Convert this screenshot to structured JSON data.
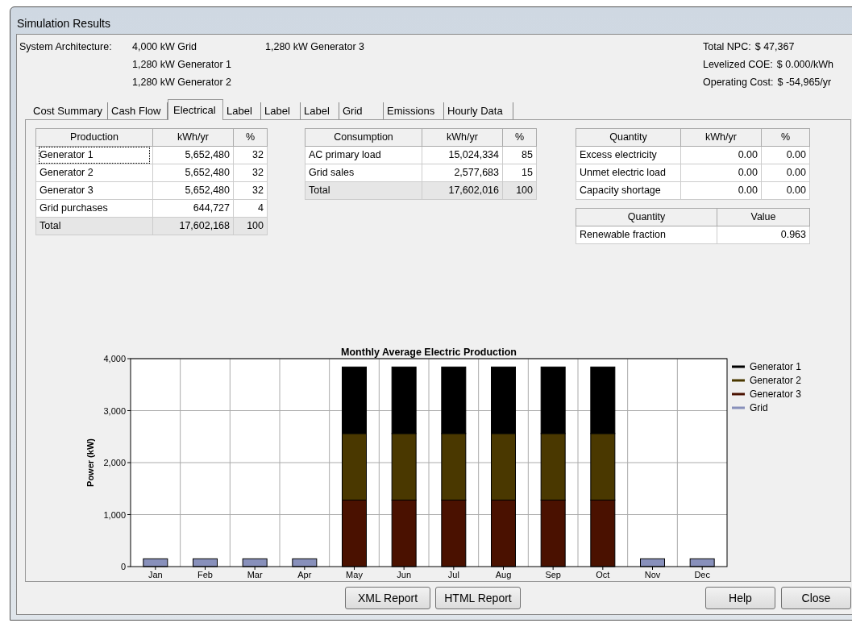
{
  "window": {
    "title": "Simulation Results"
  },
  "architecture": {
    "label": "System Architecture:",
    "components": [
      "4,000 kW Grid",
      "1,280 kW Generator 1",
      "1,280 kW Generator 2",
      "1,280 kW Generator 3"
    ]
  },
  "summary": [
    {
      "label": "Total NPC:",
      "value": "$ 47,367"
    },
    {
      "label": "Levelized COE:",
      "value": "$ 0.000/kWh"
    },
    {
      "label": "Operating Cost:",
      "value": "$ -54,965/yr"
    }
  ],
  "tabs": [
    {
      "label": "Cost Summary",
      "selected": false
    },
    {
      "label": "Cash Flow",
      "selected": false
    },
    {
      "label": "Electrical",
      "selected": true
    },
    {
      "label": "Label",
      "selected": false
    },
    {
      "label": "Label",
      "selected": false
    },
    {
      "label": "Label",
      "selected": false
    },
    {
      "label": "Grid",
      "selected": false
    },
    {
      "label": "Emissions",
      "selected": false
    },
    {
      "label": "Hourly Data",
      "selected": false
    }
  ],
  "production_table": {
    "columns": [
      "Production",
      "kWh/yr",
      "%"
    ],
    "rows": [
      {
        "cells": [
          "Generator 1",
          "5,652,480",
          "32"
        ],
        "total": false,
        "focused": true
      },
      {
        "cells": [
          "Generator 2",
          "5,652,480",
          "32"
        ],
        "total": false,
        "focused": false
      },
      {
        "cells": [
          "Generator 3",
          "5,652,480",
          "32"
        ],
        "total": false,
        "focused": false
      },
      {
        "cells": [
          "Grid purchases",
          "644,727",
          "4"
        ],
        "total": false,
        "focused": false
      },
      {
        "cells": [
          "Total",
          "17,602,168",
          "100"
        ],
        "total": true,
        "focused": false
      }
    ]
  },
  "consumption_table": {
    "columns": [
      "Consumption",
      "kWh/yr",
      "%"
    ],
    "rows": [
      {
        "cells": [
          "AC primary load",
          "15,024,334",
          "85"
        ],
        "total": false,
        "focused": false
      },
      {
        "cells": [
          "Grid sales",
          "2,577,683",
          "15"
        ],
        "total": false,
        "focused": false
      },
      {
        "cells": [
          "Total",
          "17,602,016",
          "100"
        ],
        "total": true,
        "focused": false
      }
    ]
  },
  "quantity_table": {
    "columns": [
      "Quantity",
      "kWh/yr",
      "%"
    ],
    "rows": [
      {
        "cells": [
          "Excess electricity",
          "0.00",
          "0.00"
        ],
        "total": false,
        "focused": false
      },
      {
        "cells": [
          "Unmet electric load",
          "0.00",
          "0.00"
        ],
        "total": false,
        "focused": false
      },
      {
        "cells": [
          "Capacity shortage",
          "0.00",
          "0.00"
        ],
        "total": false,
        "focused": false
      }
    ]
  },
  "value_table": {
    "columns": [
      "Quantity",
      "Value"
    ],
    "rows": [
      {
        "cells": [
          "Renewable fraction",
          "0.963"
        ],
        "total": false,
        "focused": false
      }
    ]
  },
  "chart": {
    "chart_data": {
      "type": "bar",
      "stacked": true,
      "title": "Monthly Average Electric Production",
      "ylabel": "Power (kW)",
      "categories": [
        "Jan",
        "Feb",
        "Mar",
        "Apr",
        "May",
        "Jun",
        "Jul",
        "Aug",
        "Sep",
        "Oct",
        "Nov",
        "Dec"
      ],
      "ylim": [
        0,
        4000
      ],
      "yticks": [
        {
          "value": 0,
          "label": "0"
        },
        {
          "value": 1000,
          "label": "1,000"
        },
        {
          "value": 2000,
          "label": "2,000"
        },
        {
          "value": 3000,
          "label": "3,000"
        },
        {
          "value": 4000,
          "label": "4,000"
        }
      ],
      "series": [
        {
          "name": "Grid",
          "color": "#8890bb",
          "values": [
            150,
            150,
            150,
            150,
            null,
            null,
            null,
            null,
            null,
            null,
            150,
            150
          ]
        },
        {
          "name": "Generator 3",
          "color": "#4a1100",
          "values": [
            null,
            null,
            null,
            null,
            1280,
            1280,
            1280,
            1280,
            1280,
            1280,
            null,
            null
          ]
        },
        {
          "name": "Generator 2",
          "color": "#4a3800",
          "values": [
            null,
            null,
            null,
            null,
            1280,
            1280,
            1280,
            1280,
            1280,
            1280,
            null,
            null
          ]
        },
        {
          "name": "Generator 1",
          "color": "#000000",
          "values": [
            null,
            null,
            null,
            null,
            1280,
            1280,
            1280,
            1280,
            1280,
            1280,
            null,
            null
          ]
        }
      ],
      "grid": true,
      "legend": {
        "reversed": true
      }
    }
  },
  "buttons_center": [
    "XML Report",
    "HTML Report"
  ],
  "buttons_right": [
    "Help",
    "Close"
  ]
}
